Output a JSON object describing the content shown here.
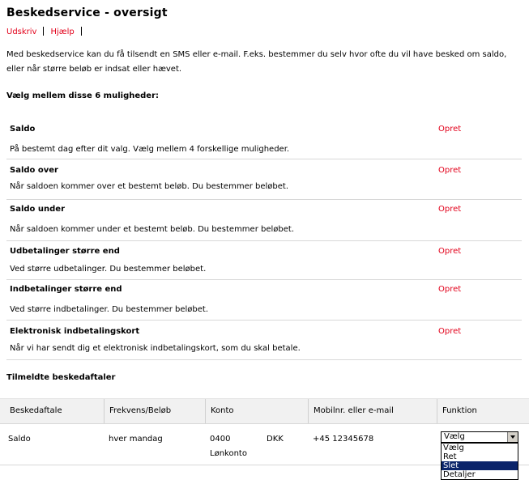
{
  "page": {
    "title": "Beskedservice - oversigt",
    "links": [
      "Udskriv",
      "Hjælp"
    ],
    "intro": "Med beskedservice kan du få tilsendt en SMS eller e-mail. F.eks. bestemmer du selv hvor ofte du vil have besked om saldo, eller når større beløb er indsat eller hævet.",
    "choose_heading": "Vælg mellem disse 6 muligheder:"
  },
  "options": [
    {
      "title": "Saldo",
      "action": "Opret",
      "desc": "På bestemt dag efter dit valg. Vælg mellem 4 forskellige muligheder."
    },
    {
      "title": "Saldo over",
      "action": "Opret",
      "desc": "Når saldoen kommer over et bestemt beløb. Du bestemmer beløbet."
    },
    {
      "title": "Saldo under",
      "action": "Opret",
      "desc": "Når saldoen kommer under et bestemt beløb. Du bestemmer beløbet."
    },
    {
      "title": "Udbetalinger større end",
      "action": "Opret",
      "desc": "Ved større udbetalinger. Du bestemmer beløbet."
    },
    {
      "title": "Indbetalinger større end",
      "action": "Opret",
      "desc": "Ved større indbetalinger. Du bestemmer beløbet."
    },
    {
      "title": "Elektronisk indbetalingskort",
      "action": "Opret",
      "desc": "Når vi har sendt dig et elektronisk indbetalingskort, som du skal betale."
    }
  ],
  "subscriptions": {
    "heading": "Tilmeldte beskedaftaler",
    "headers": [
      "Beskedaftale",
      "Frekvens/Beløb",
      "Konto",
      "Mobilnr. eller e-mail",
      "Funktion"
    ],
    "rows": [
      {
        "agreement": "Saldo",
        "frequency": "hver mandag",
        "account_no": "0400",
        "account_name": "Lønkonto",
        "currency": "DKK",
        "contact": "+45 12345678",
        "function_select": {
          "value": "Vælg",
          "options": [
            "Vælg",
            "Ret",
            "Slet",
            "Detaljer"
          ],
          "highlighted": "Slet"
        }
      }
    ]
  },
  "colors": {
    "link": "#e2001a",
    "header_bg": "#f1f1f1",
    "highlight": "#0a246a"
  }
}
